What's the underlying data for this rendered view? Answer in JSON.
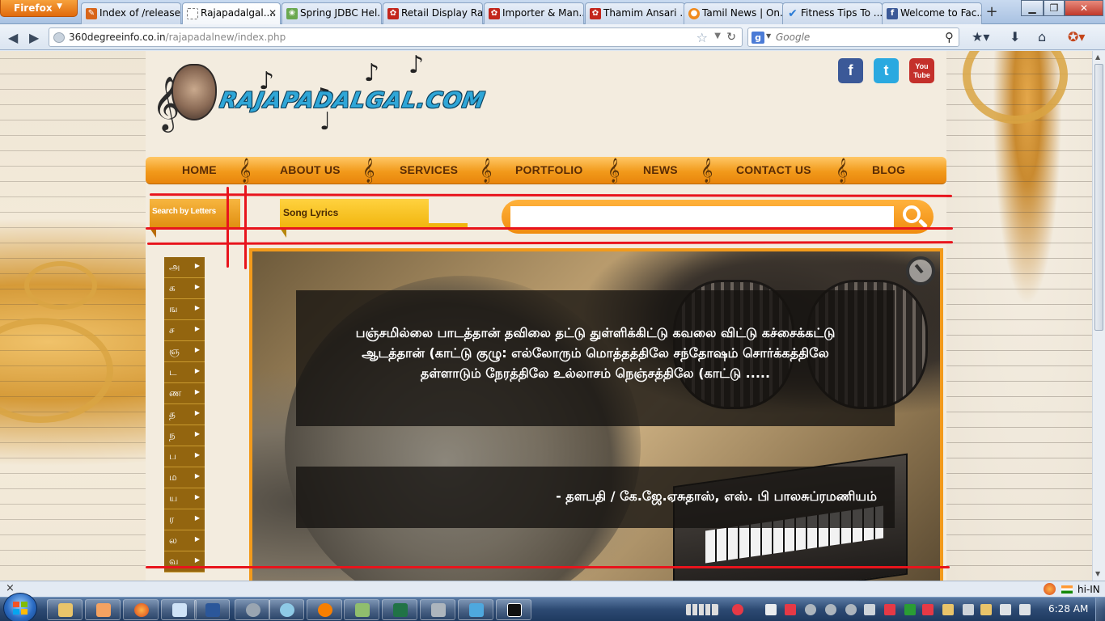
{
  "browser": {
    "menu_button": "Firefox",
    "tabs": [
      {
        "label": "Index of /release...",
        "icon": "firefox-page-icon",
        "color": "#d8651a"
      },
      {
        "label": "Rajapadalgal....",
        "icon": "blank-page-icon",
        "color": "#ffffff",
        "active": true
      },
      {
        "label": "Spring JDBC Hel...",
        "icon": "spring-icon",
        "color": "#6aa84f"
      },
      {
        "label": "Retail Display Ra...",
        "icon": "red-logo-icon",
        "color": "#c3261c"
      },
      {
        "label": "Importer & Man...",
        "icon": "red-logo-icon",
        "color": "#c3261c"
      },
      {
        "label": "Thamim Ansari ...",
        "icon": "red-logo-icon",
        "color": "#c3261c"
      },
      {
        "label": "Tamil News | On...",
        "icon": "orange-circle-icon",
        "color": "#f08a1c"
      },
      {
        "label": "Fitness Tips To ...",
        "icon": "checkmark-icon",
        "color": "#2a7bd6"
      },
      {
        "label": "Welcome to Fac...",
        "icon": "facebook-icon",
        "color": "#3b5998"
      }
    ],
    "new_tab": "+",
    "url_domain": "360degreeinfo.co.in",
    "url_path": "/rajapadalnew/index.php",
    "search_engine": "Google",
    "search_placeholder": "Google"
  },
  "site": {
    "logo_text": "RAJAPADALGAL.COM",
    "social": [
      {
        "name": "facebook",
        "glyph": "f",
        "color": "#3b5998"
      },
      {
        "name": "twitter",
        "glyph": "t",
        "color": "#2aa9e0"
      },
      {
        "name": "youtube",
        "glyph": "You Tube",
        "color": "#c4302b"
      }
    ],
    "nav": [
      "HOME",
      "ABOUT US",
      "SERVICES",
      "PORTFOLIO",
      "NEWS",
      "CONTACT US",
      "BLOG"
    ],
    "search_by_letters": "Search by Letters",
    "song_lyrics": "Song Lyrics",
    "search_value": "",
    "letters": [
      "அ",
      "க",
      "ங",
      "ச",
      "ஞ",
      "ட",
      "ண",
      "த",
      "ந",
      "ப",
      "ம",
      "ய",
      "ர",
      "ல",
      "வ"
    ],
    "lyric": "பஞ்சமில்லை பாடத்தான் தவிலை தட்டு துள்ளிக்கிட்டு கவலை விட்டு கச்சைக்கட்டு ஆடத்தான் (காட்டு குழு: எல்லோரும் மொத்தத்திலே சந்தோஷம் சொர்க்கத்திலே தள்ளாடும் நேரத்திலே உல்லாசம் நெஞ்சத்திலே (காட்டு .....",
    "credit": "- தளபதி / கே.ஜே.ஏசுதாஸ், எஸ். பி பாலசுப்ரமணியம்"
  },
  "statusbar": {
    "close": "×",
    "language": "hi-IN"
  },
  "taskbar": {
    "clock": "6:28 AM",
    "apps": [
      "explorer",
      "media-player",
      "firefox",
      "notepad",
      "word",
      "settings",
      "messenger",
      "avast",
      "paint",
      "excel",
      "remote",
      "netbeans",
      "dict"
    ],
    "accent": "#2d4a73"
  }
}
